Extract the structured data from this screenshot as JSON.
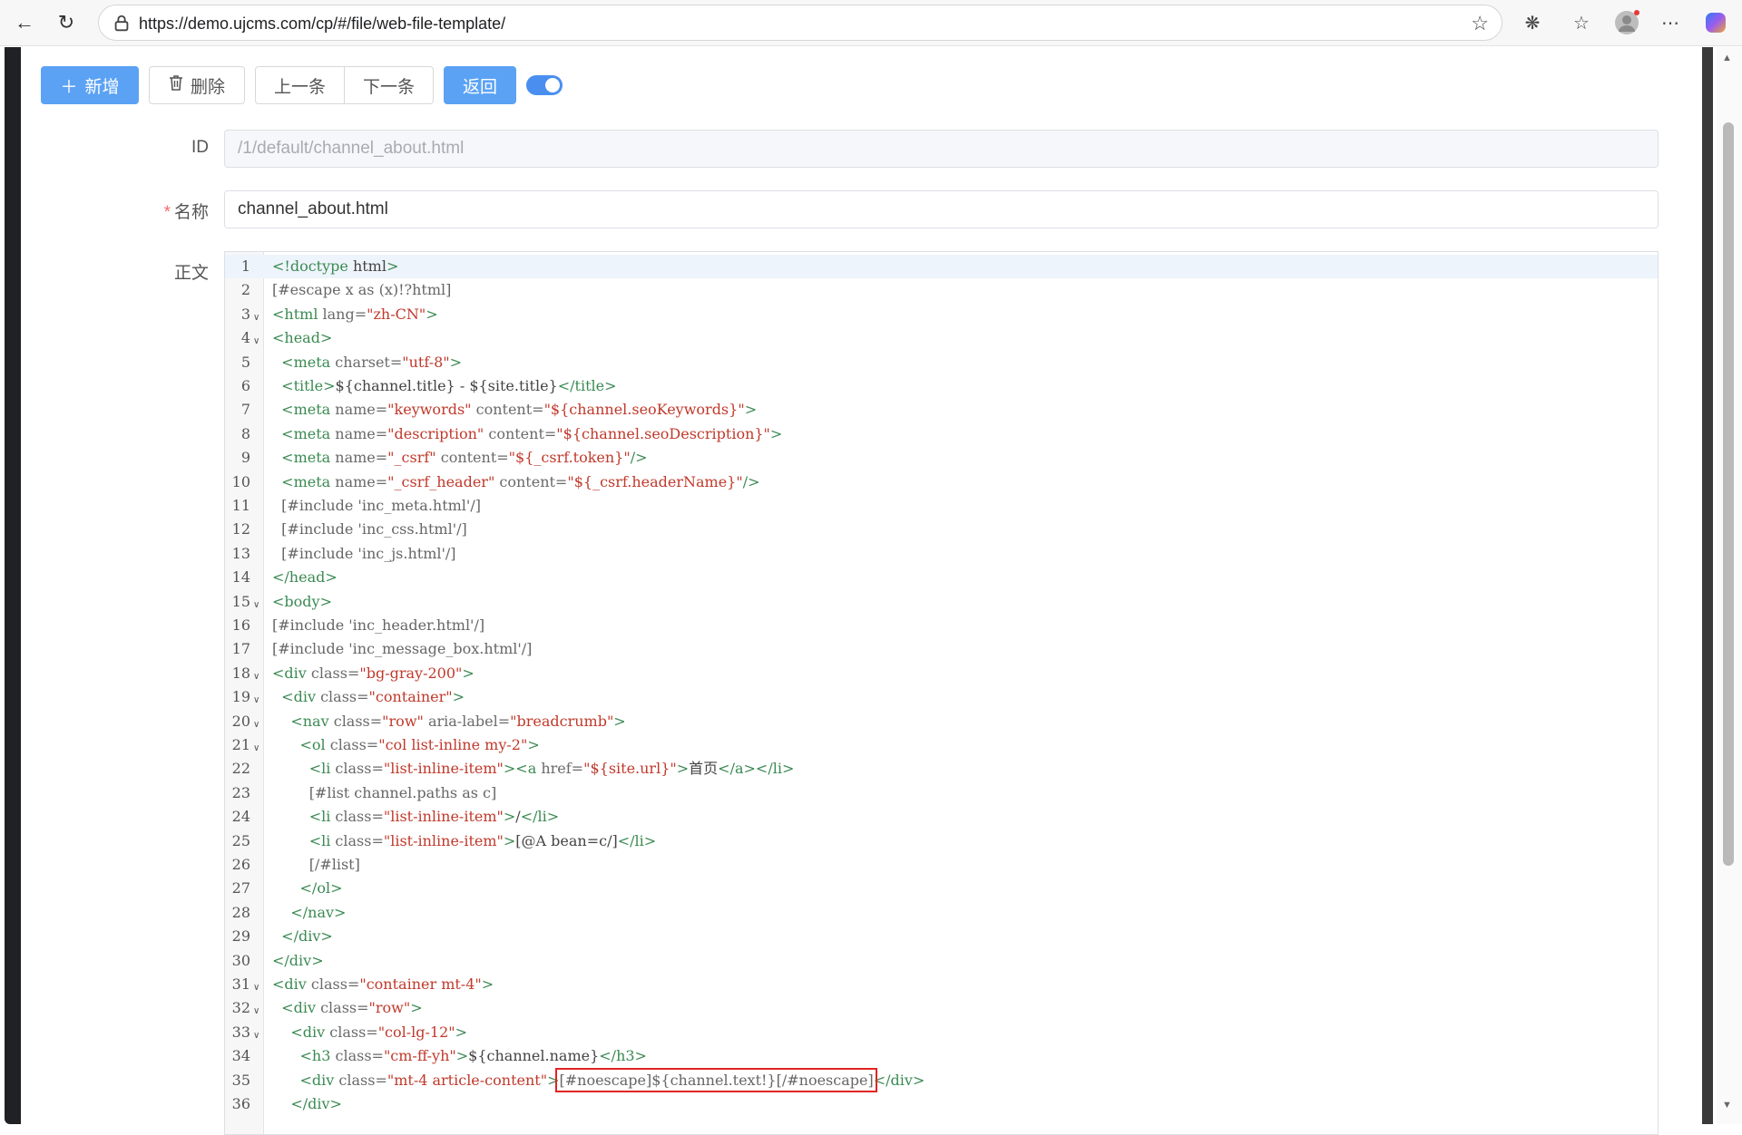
{
  "browser": {
    "url": "https://demo.ujcms.com/cp/#/file/web-file-template/"
  },
  "toolbar": {
    "add_label": "新增",
    "delete_label": "删除",
    "prev_label": "上一条",
    "next_label": "下一条",
    "back_label": "返回",
    "toggle_on": true
  },
  "form": {
    "id_label": "ID",
    "id_value": "/1/default/channel_about.html",
    "name_label": "名称",
    "name_value": "channel_about.html",
    "body_label": "正文"
  },
  "editor": {
    "lines": [
      "<!doctype html>",
      "[#escape x as (x)!?html]",
      "<html lang=\"zh-CN\">",
      "<head>",
      "  <meta charset=\"utf-8\">",
      "  <title>${channel.title} - ${site.title}</title>",
      "  <meta name=\"keywords\" content=\"${channel.seoKeywords}\">",
      "  <meta name=\"description\" content=\"${channel.seoDescription}\">",
      "  <meta name=\"_csrf\" content=\"${_csrf.token}\"/>",
      "  <meta name=\"_csrf_header\" content=\"${_csrf.headerName}\"/>",
      "  [#include 'inc_meta.html'/]",
      "  [#include 'inc_css.html'/]",
      "  [#include 'inc_js.html'/]",
      "</head>",
      "<body>",
      "[#include 'inc_header.html'/]",
      "[#include 'inc_message_box.html'/]",
      "<div class=\"bg-gray-200\">",
      "  <div class=\"container\">",
      "    <nav class=\"row\" aria-label=\"breadcrumb\">",
      "      <ol class=\"col list-inline my-2\">",
      "        <li class=\"list-inline-item\"><a href=\"${site.url}\">首页</a></li>",
      "        [#list channel.paths as c]",
      "        <li class=\"list-inline-item\">/</li>",
      "        <li class=\"list-inline-item\">[@A bean=c/]</li>",
      "        [/#list]",
      "      </ol>",
      "    </nav>",
      "  </div>",
      "</div>",
      "<div class=\"container mt-4\">",
      "  <div class=\"row\">",
      "    <div class=\"col-lg-12\">",
      "      <h3 class=\"cm-ff-yh\">${channel.name}</h3>",
      "      <div class=\"mt-4 article-content\">[#noescape]${channel.text!}[/#noescape]</div>",
      "    </div>"
    ],
    "fold_lines": [
      3,
      4,
      15,
      18,
      19,
      20,
      21,
      31,
      32,
      33
    ],
    "highlight": {
      "line": 35,
      "text": "[#noescape]${channel.text!}[/#noescape]"
    }
  }
}
